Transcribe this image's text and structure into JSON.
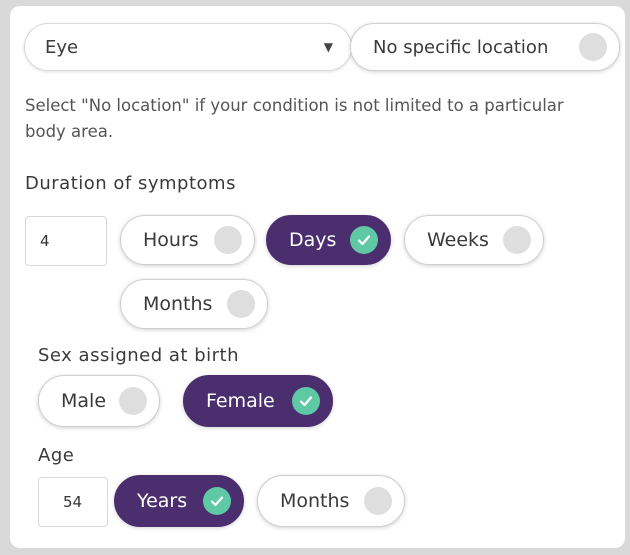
{
  "location": {
    "selected": "Eye",
    "no_location_label": "No specific location",
    "help_text": "Select \"No location\" if your condition is not limited to a particular body area."
  },
  "duration": {
    "label": "Duration of symptoms",
    "value": "4",
    "units": [
      "Hours",
      "Days",
      "Weeks",
      "Months"
    ],
    "selected_unit": "Days"
  },
  "sex": {
    "label": "Sex assigned at birth",
    "options": [
      "Male",
      "Female"
    ],
    "selected": "Female"
  },
  "age": {
    "label": "Age",
    "value": "54",
    "units": [
      "Years",
      "Months"
    ],
    "selected_unit": "Years"
  },
  "colors": {
    "selected_bg": "#4b2e6e",
    "check_bg": "#5fc9a6",
    "unchecked_dot": "#dedede"
  }
}
